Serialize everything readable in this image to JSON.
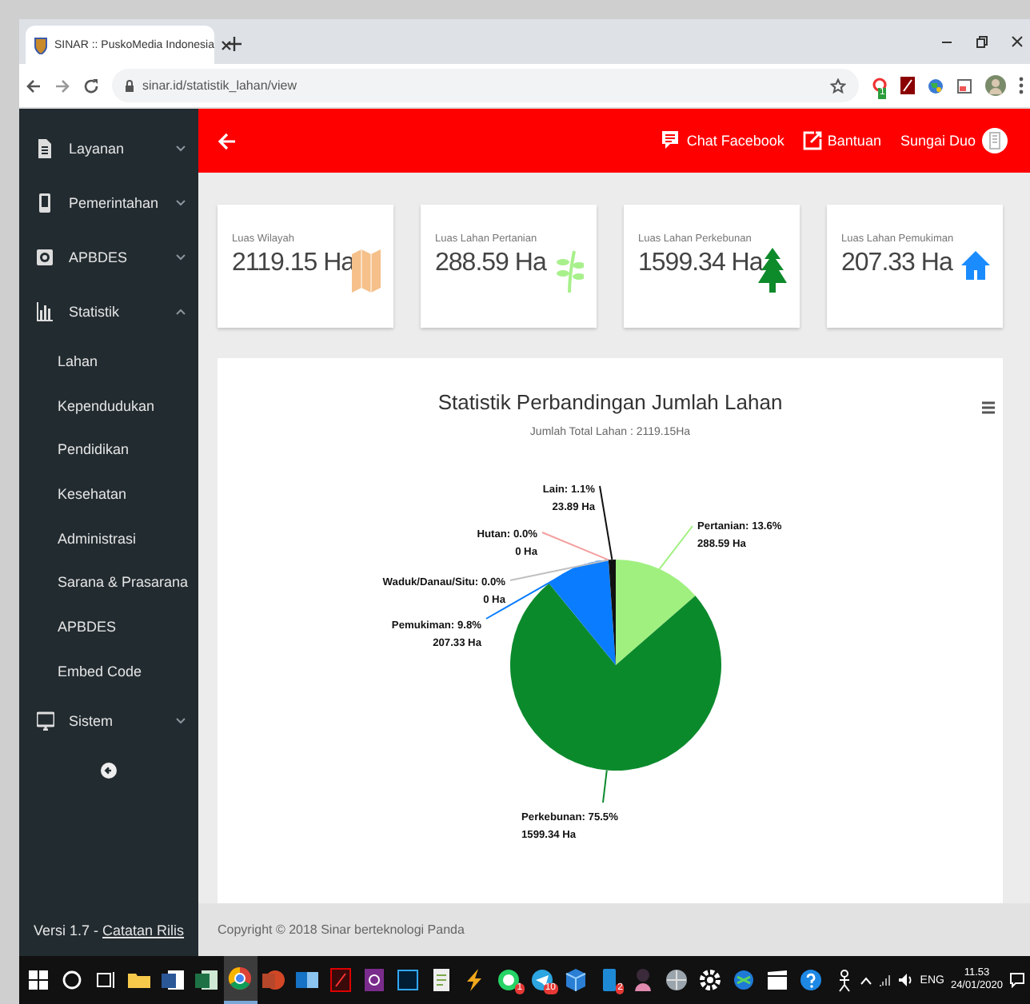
{
  "browser": {
    "tab_title": "SINAR :: PuskoMedia Indonesia",
    "url": "sinar.id/statistik_lahan/view",
    "extension_badge": "1"
  },
  "sidebar": {
    "items": [
      {
        "label": "Layanan",
        "kind": "document",
        "expanded": false
      },
      {
        "label": "Pemerintahan",
        "kind": "phone",
        "expanded": false
      },
      {
        "label": "APBDES",
        "kind": "coin",
        "expanded": false
      },
      {
        "label": "Statistik",
        "kind": "chart",
        "expanded": true,
        "children": [
          {
            "label": "Lahan"
          },
          {
            "label": "Kependudukan"
          },
          {
            "label": "Pendidikan"
          },
          {
            "label": "Kesehatan"
          },
          {
            "label": "Administrasi"
          },
          {
            "label": "Sarana & Prasarana"
          },
          {
            "label": "APBDES"
          },
          {
            "label": "Embed Code"
          }
        ]
      },
      {
        "label": "Sistem",
        "kind": "monitor",
        "expanded": false
      }
    ],
    "version": "Versi 1.7 - ",
    "release_link": "Catatan Rilis"
  },
  "header": {
    "actions": [
      {
        "label": "Chat Facebook",
        "kind": "chat"
      },
      {
        "label": "Bantuan",
        "kind": "external"
      }
    ],
    "user": "Sungai Duo"
  },
  "cards": [
    {
      "label": "Luas Wilayah",
      "value": "2119.15 Ha",
      "kind": "map",
      "color": "#f5c08a"
    },
    {
      "label": "Luas Lahan Pertanian",
      "value": "288.59 Ha",
      "kind": "leaf",
      "color": "#a8f08c"
    },
    {
      "label": "Luas Lahan Perkebunan",
      "value": "1599.34 Ha",
      "kind": "tree",
      "color": "#0d8a2a"
    },
    {
      "label": "Luas Lahan Pemukiman",
      "value": "207.33 Ha",
      "kind": "house",
      "color": "#1a8cff"
    }
  ],
  "chart": {
    "subtitle": "Jumlah Total Lahan : 2119.15Ha",
    "chart_data": {
      "type": "pie",
      "title": "Statistik Perbandingan Jumlah Lahan",
      "series": [
        {
          "values": [
            13.6,
            75.5,
            9.8,
            0,
            0,
            1.1
          ]
        }
      ],
      "colors": [
        "#a0f080",
        "#0b8a2c",
        "#0a7cff",
        "#c0c0c0",
        "#f4a0a0",
        "#111111"
      ],
      "value_labels": [
        [
          "Pertanian: 13.6%",
          "288.59 Ha"
        ],
        [
          "Perkebunan: 75.5%",
          "1599.34 Ha"
        ],
        [
          "Pemukiman: 9.8%",
          "207.33 Ha"
        ],
        [
          "Waduk/Danau/Situ: 0.0%",
          "0 Ha"
        ],
        [
          "Hutan: 0.0%",
          "0 Ha"
        ],
        [
          "Lain: 1.1%",
          "23.89 Ha"
        ]
      ]
    }
  },
  "footer": "Copyright © 2018 Sinar berteknologi Panda",
  "taskbar": {
    "apps": [
      {
        "kind": "start",
        "selected": false
      },
      {
        "kind": "search",
        "selected": false
      },
      {
        "kind": "taskview",
        "selected": false
      },
      {
        "kind": "folder",
        "selected": false
      },
      {
        "kind": "doc",
        "selected": false
      },
      {
        "kind": "sheet",
        "selected": false
      },
      {
        "kind": "browser",
        "selected": true
      },
      {
        "kind": "slides",
        "selected": false
      },
      {
        "kind": "mail",
        "selected": false
      },
      {
        "kind": "pdf",
        "selected": false
      },
      {
        "kind": "purple",
        "selected": false
      },
      {
        "kind": "imageeditor",
        "selected": false
      },
      {
        "kind": "notepad",
        "selected": false
      },
      {
        "kind": "bolt",
        "selected": false
      },
      {
        "kind": "chat",
        "selected": false,
        "badge": "1"
      },
      {
        "kind": "plane",
        "selected": false,
        "badge": "10"
      },
      {
        "kind": "cube",
        "selected": false
      },
      {
        "kind": "phone",
        "selected": false,
        "badge": "2"
      },
      {
        "kind": "figure",
        "selected": false
      },
      {
        "kind": "globe",
        "selected": false
      },
      {
        "kind": "gear",
        "selected": false
      },
      {
        "kind": "network",
        "selected": false
      },
      {
        "kind": "clapper",
        "selected": false
      },
      {
        "kind": "help",
        "selected": false
      },
      {
        "kind": "person",
        "selected": false
      }
    ],
    "language": "ENG",
    "time": "11.53",
    "date": "24/01/2020"
  }
}
